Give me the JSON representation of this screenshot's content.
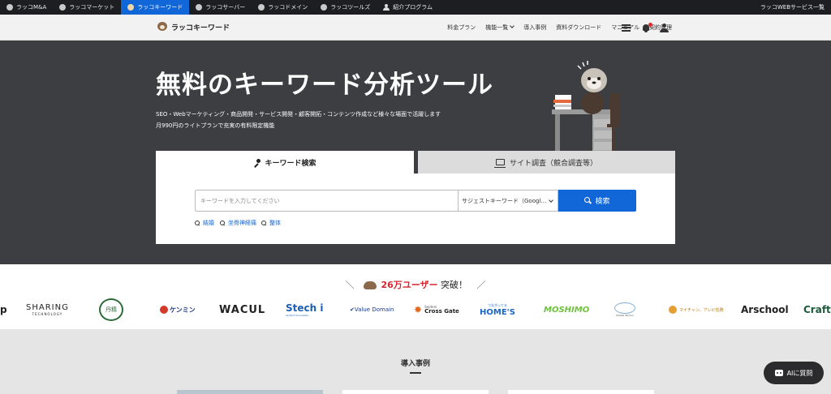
{
  "service_bar": {
    "items": [
      {
        "label": "ラッコM&A",
        "active": false
      },
      {
        "label": "ラッコマーケット",
        "active": false
      },
      {
        "label": "ラッコキーワード",
        "active": true
      },
      {
        "label": "ラッコサーバー",
        "active": false
      },
      {
        "label": "ラッコドメイン",
        "active": false
      },
      {
        "label": "ラッコツールズ",
        "active": false
      },
      {
        "label": "紹介プログラム",
        "active": false
      }
    ],
    "all_services_label": "ラッコWEBサービス一覧",
    "active_color": "#1166d8"
  },
  "header": {
    "logo_text": "ラッコキーワード",
    "nav": {
      "pricing": "料金プラン",
      "features": "機能一覧",
      "cases": "導入事例",
      "download": "資料ダウンロード",
      "manual": "マニュアル",
      "contract": "契約管理"
    },
    "icons": [
      "menu-icon",
      "bell-icon",
      "user-icon"
    ]
  },
  "hero": {
    "title": "無料のキーワード分析ツール",
    "desc_line1": "SEO・Webマーケティング・商品開発・サービス開発・顧客開拓・コンテンツ作成など様々な場面で活躍します",
    "desc_line2": "月990円のライトプランで充実の有料限定機能",
    "bg_color": "#3d3e42"
  },
  "search": {
    "tab_keyword": "キーワード検索",
    "tab_site": "サイト調査（競合調査等）",
    "placeholder": "キーワードを入力してください",
    "select_value": "サジェストキーワード（Googl…",
    "button_label": "検索",
    "suggestions": [
      "結婚",
      "坐骨神経痛",
      "整体"
    ],
    "button_color": "#1166d8"
  },
  "clients": {
    "count_text": "26万ユーザー",
    "suffix_text": "突破！",
    "logos": [
      {
        "name": "SHARING",
        "sub": "TECHNOLOGY"
      },
      {
        "name": "丹精"
      },
      {
        "name": "ケンミン"
      },
      {
        "name": "WACUL"
      },
      {
        "name": "Stech i",
        "sub": "ssi-Tech Innovation"
      },
      {
        "name": "Value Domain"
      },
      {
        "name": "Septeni",
        "sub": "Cross Gate"
      },
      {
        "name": "HOME'S",
        "sub": "つながってる"
      },
      {
        "name": "MOSHIMO"
      },
      {
        "name": "Mobile Techno"
      },
      {
        "name": "マイチャン。アレビ任務"
      },
      {
        "name": "Arschool"
      },
      {
        "name": "CraftE"
      }
    ],
    "accent_color": "#d6262e"
  },
  "cases": {
    "title": "導入事例"
  },
  "ai_chat": {
    "label": "AIに質問"
  }
}
